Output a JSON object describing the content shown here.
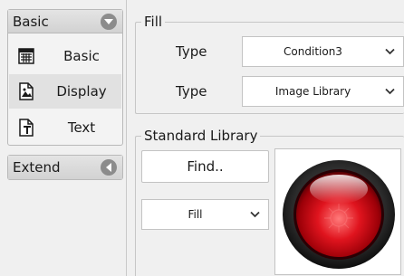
{
  "sidebar": {
    "groups": [
      {
        "title": "Basic",
        "toggle_icon": "chevron-down-icon",
        "items": [
          {
            "label": "Basic",
            "icon": "grid-table-icon",
            "selected": false
          },
          {
            "label": "Display",
            "icon": "image-document-icon",
            "selected": true
          },
          {
            "label": "Text",
            "icon": "text-document-icon",
            "selected": false
          }
        ]
      },
      {
        "title": "Extend",
        "toggle_icon": "chevron-left-icon",
        "items": []
      }
    ]
  },
  "fill": {
    "legend": "Fill",
    "rows": [
      {
        "label": "Type",
        "value": "Condition3"
      },
      {
        "label": "Type",
        "value": "Image Library"
      }
    ]
  },
  "library": {
    "legend": "Standard Library",
    "find_label": "Find..",
    "fill_select_value": "Fill",
    "preview": {
      "icon": "red-round-lamp",
      "colors": {
        "lamp": "#e0141e",
        "bezel": "#2a2a2a"
      }
    }
  },
  "colors": {
    "background": "#f0f0f0",
    "toggle": "#8c8c8c",
    "border": "#c3c3c3"
  }
}
